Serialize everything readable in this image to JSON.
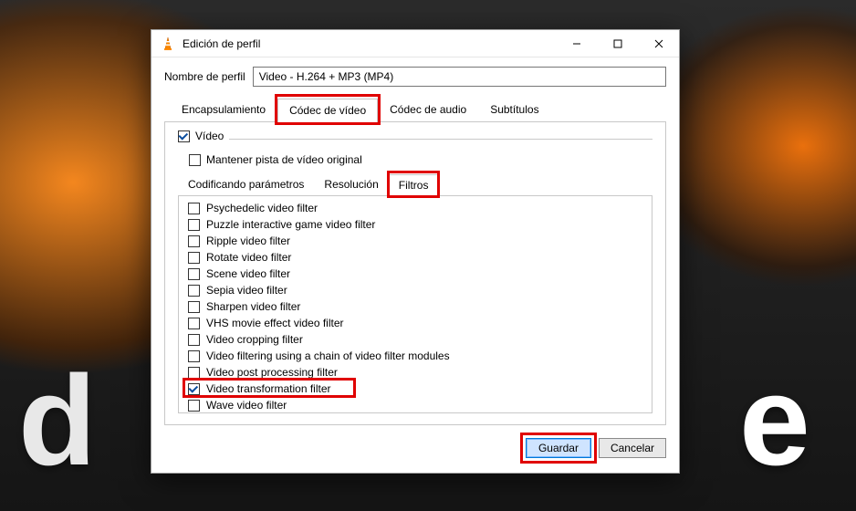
{
  "window": {
    "title": "Edición de perfil",
    "profile_label": "Nombre de perfil",
    "profile_value": "Video - H.264 + MP3 (MP4)"
  },
  "outer_tabs": [
    {
      "id": "encap",
      "label": "Encapsulamiento",
      "active": false
    },
    {
      "id": "vcodec",
      "label": "Códec de vídeo",
      "active": true,
      "highlight": true
    },
    {
      "id": "acodec",
      "label": "Códec de audio",
      "active": false
    },
    {
      "id": "subs",
      "label": "Subtítulos",
      "active": false
    }
  ],
  "video_group": {
    "video_label": "Vídeo",
    "video_checked": true,
    "keep_original_label": "Mantener pista de vídeo original",
    "keep_original_checked": false
  },
  "inner_tabs": [
    {
      "id": "params",
      "label": "Codificando parámetros",
      "active": false
    },
    {
      "id": "res",
      "label": "Resolución",
      "active": false
    },
    {
      "id": "filters",
      "label": "Filtros",
      "active": true,
      "highlight": true
    }
  ],
  "filters": [
    {
      "label": "Psychedelic video filter",
      "checked": false
    },
    {
      "label": "Puzzle interactive game video filter",
      "checked": false
    },
    {
      "label": "Ripple video filter",
      "checked": false
    },
    {
      "label": "Rotate video filter",
      "checked": false
    },
    {
      "label": "Scene video filter",
      "checked": false
    },
    {
      "label": "Sepia video filter",
      "checked": false
    },
    {
      "label": "Sharpen video filter",
      "checked": false
    },
    {
      "label": "VHS movie effect video filter",
      "checked": false
    },
    {
      "label": "Video cropping filter",
      "checked": false
    },
    {
      "label": "Video filtering using a chain of video filter modules",
      "checked": false
    },
    {
      "label": "Video post processing filter",
      "checked": false
    },
    {
      "label": "Video transformation filter",
      "checked": true,
      "highlight": true
    },
    {
      "label": "Wave video filter",
      "checked": false
    }
  ],
  "actions": {
    "save_label": "Guardar",
    "cancel_label": "Cancelar"
  },
  "bg_text_left": "d",
  "bg_text_right": "e"
}
